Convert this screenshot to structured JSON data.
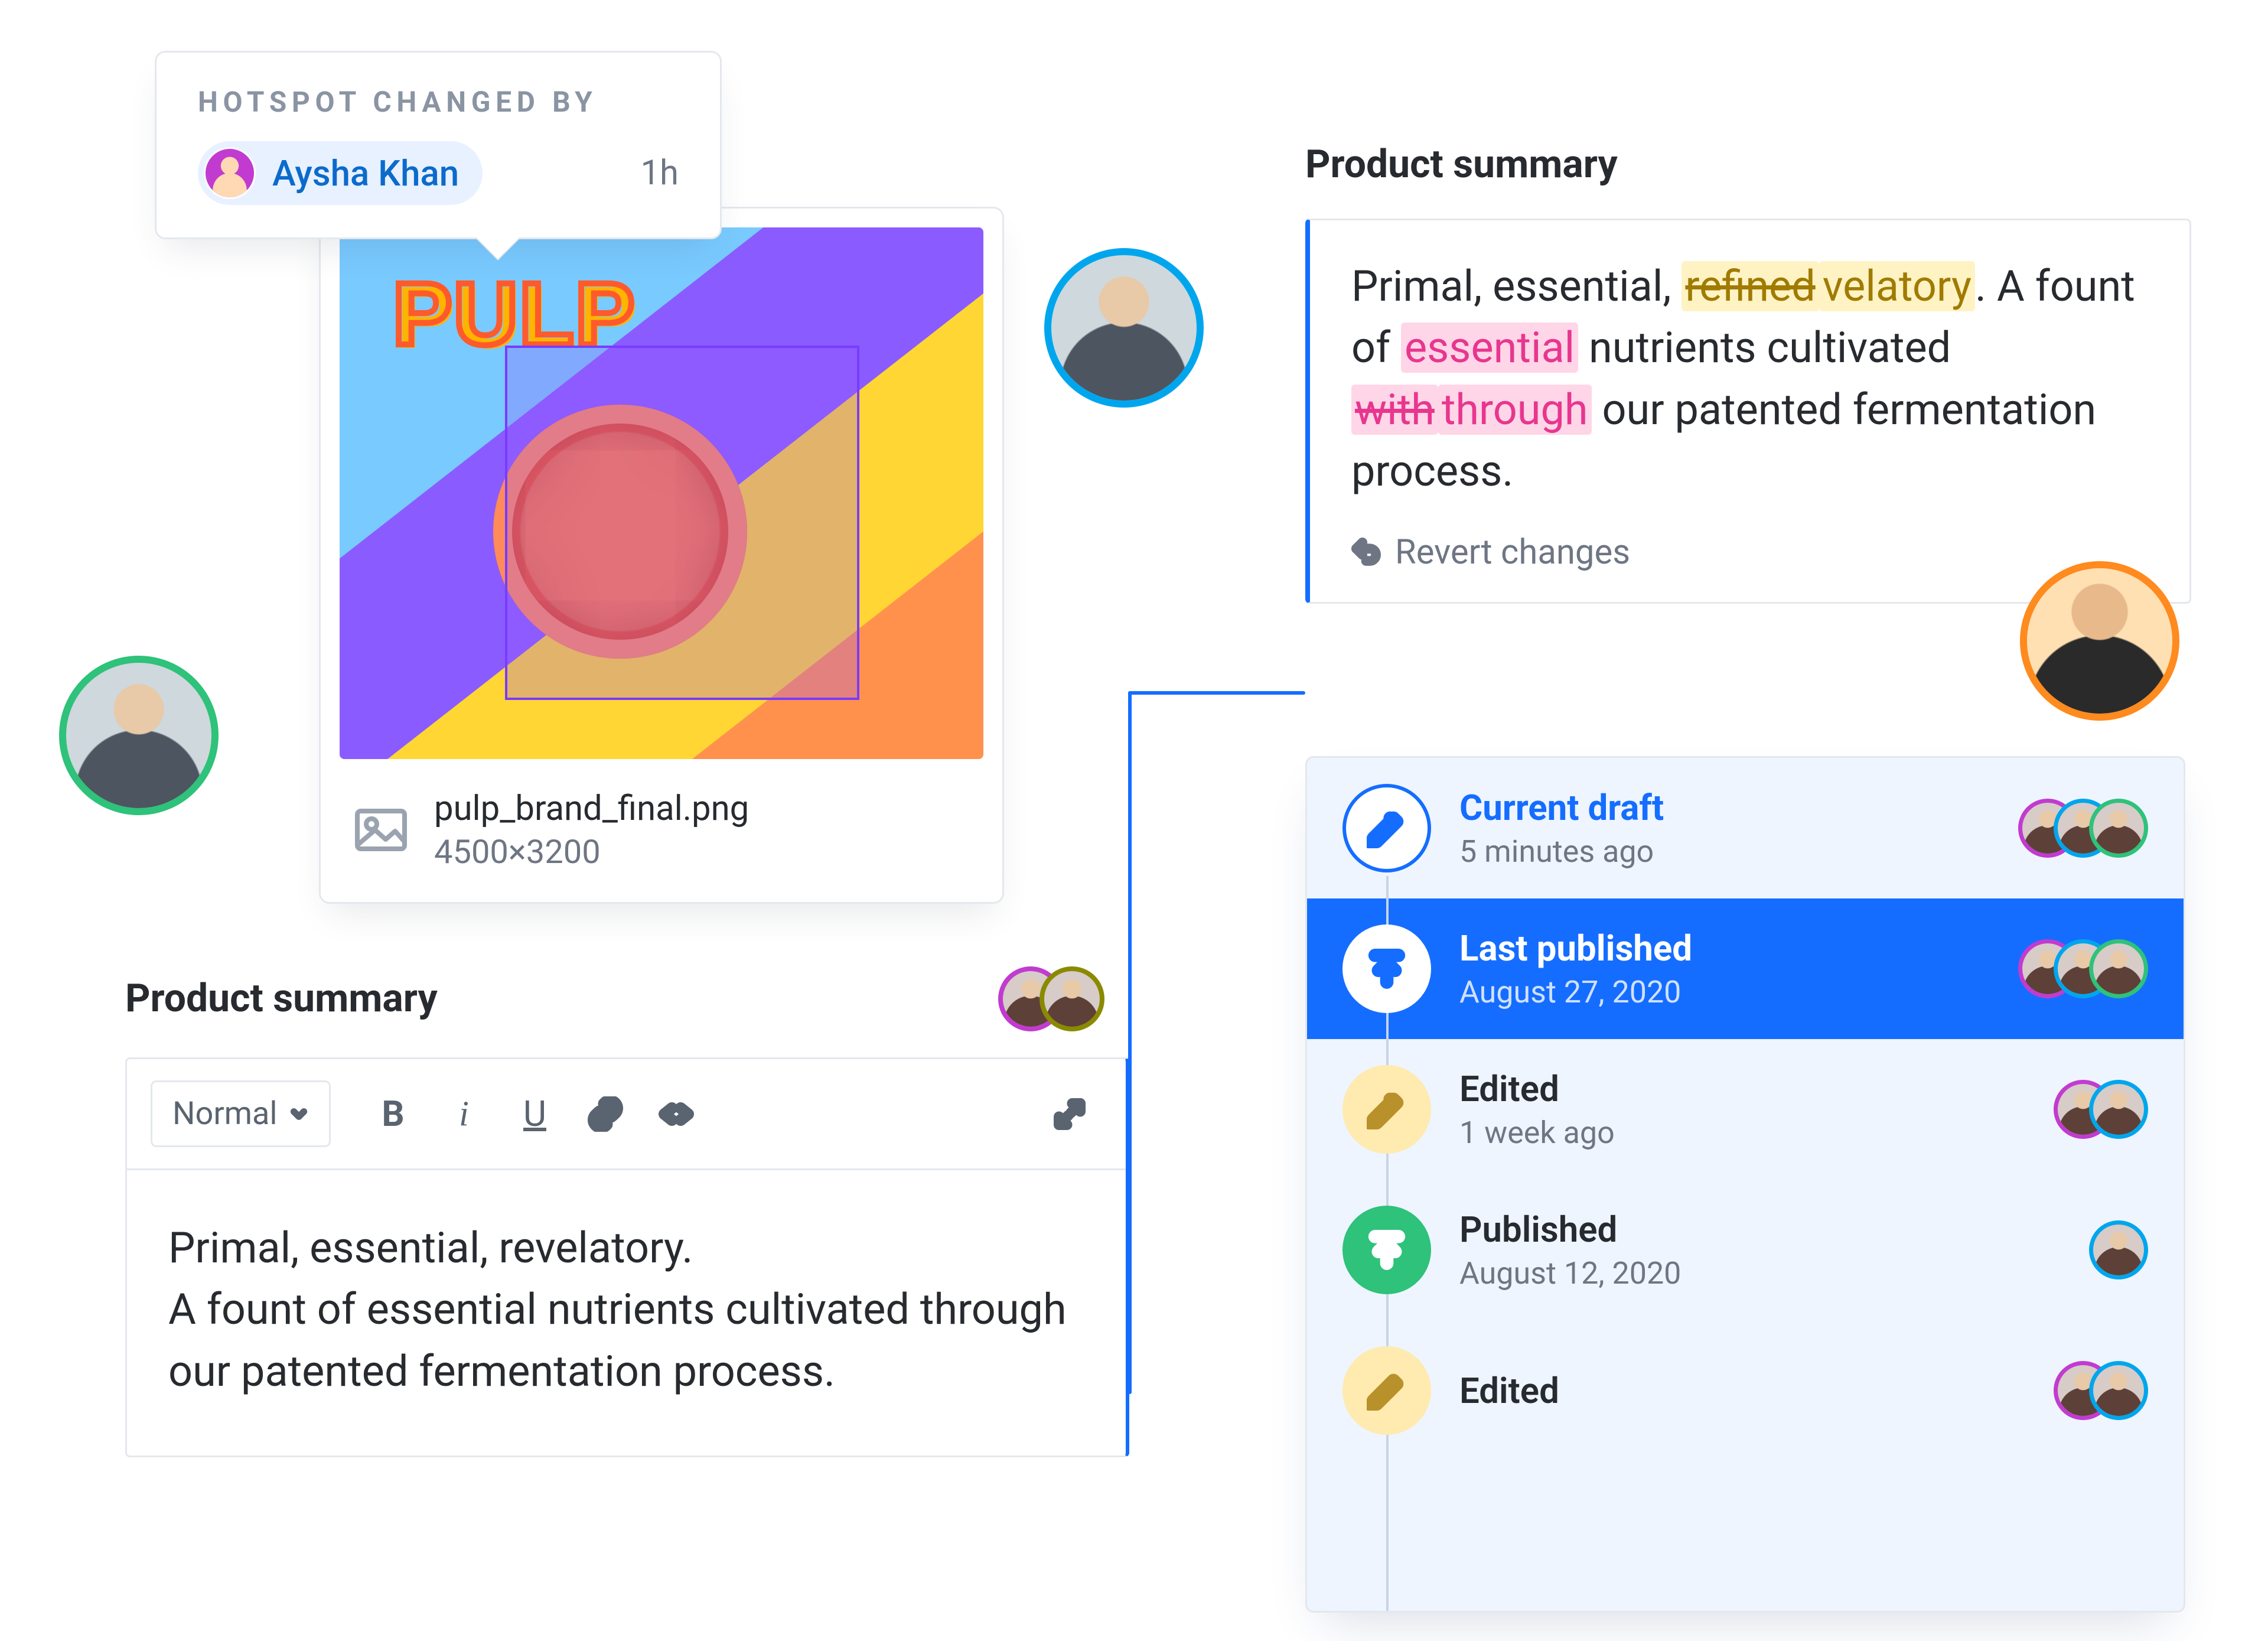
{
  "hotspot": {
    "title": "HOTSPOT CHANGED BY",
    "user": "Aysha Khan",
    "time": "1h"
  },
  "image_card": {
    "logo_text": "PULP",
    "filename": "pulp_brand_final.png",
    "dimensions": "4500×3200"
  },
  "editor": {
    "title": "Product summary",
    "style_select": "Normal",
    "body": "Primal, essential, revelatory.\nA fount of essential nutrients cultivated through our patented fermentation process."
  },
  "diff": {
    "title": "Product summary",
    "text_pre": "Primal, essential, ",
    "removed1": "refined",
    "added1": "velatory",
    "text_mid1": ". A fount of ",
    "hl_pink1": "essential",
    "text_mid2": " nutrients cultivated ",
    "removed2": "with",
    "added2": "through",
    "text_post": " our patented fermentation process.",
    "revert_label": "Revert changes"
  },
  "history": {
    "items": [
      {
        "title": "Current draft",
        "subtitle": "5 minutes ago"
      },
      {
        "title": "Last published",
        "subtitle": "August 27, 2020"
      },
      {
        "title": "Edited",
        "subtitle": "1 week ago"
      },
      {
        "title": "Published",
        "subtitle": "August 12, 2020"
      },
      {
        "title": "Edited",
        "subtitle": ""
      }
    ]
  },
  "colors": {
    "blue": "#156dff",
    "green": "#2ec27a",
    "orange": "#ff8a1e",
    "magenta": "#c23bd0",
    "yellow": "#f5d547"
  }
}
